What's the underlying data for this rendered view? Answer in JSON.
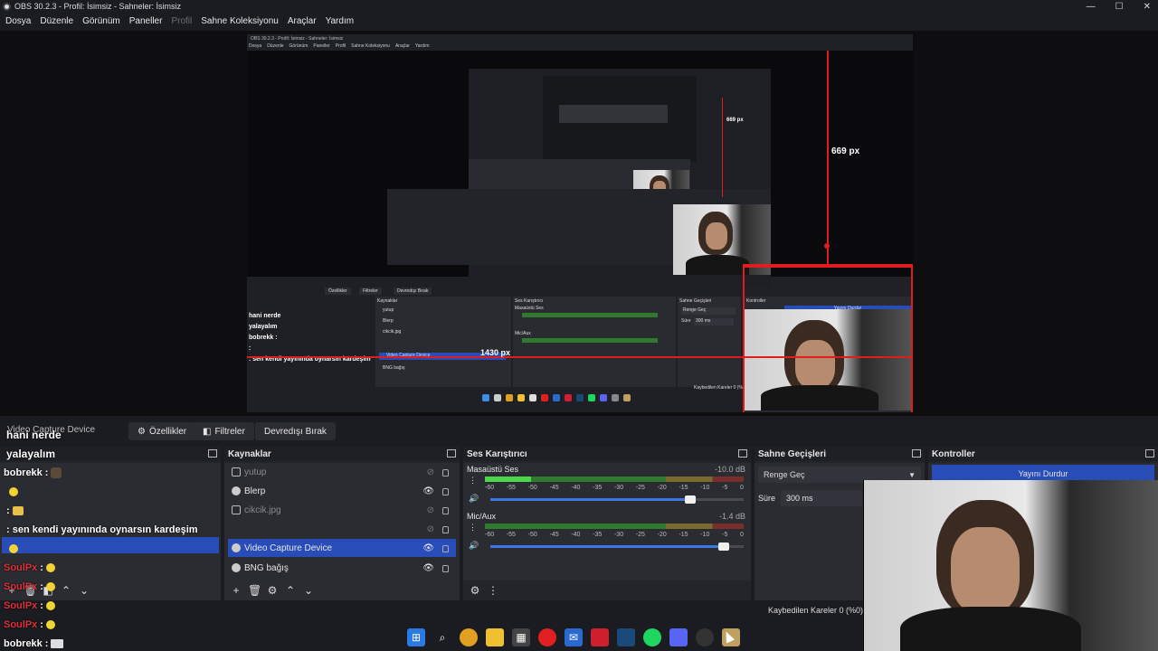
{
  "window": {
    "title": "OBS 30.2.3 - Profil: İsimsiz - Sahneler: İsimsiz",
    "controls": [
      "—",
      "☐",
      "✕"
    ]
  },
  "menu": {
    "items": [
      "Dosya",
      "Düzenle",
      "Görünüm",
      "Paneller",
      "Profil",
      "Sahne Koleksiyonu",
      "Araçlar",
      "Yardım"
    ]
  },
  "preview": {
    "nested_title": "OBS 30.2.3 - Profil: İsimsiz - Sahneler: İsimsiz",
    "measure_669": "669 px",
    "measure_1430": "1430 px",
    "measure_669_small": "669 px",
    "nested_toolbar": [
      "Özellikler",
      "Filtreler",
      "Devredışı Bırak"
    ],
    "nested_docks": [
      "Kaynaklar",
      "Ses Karıştırıcı",
      "Sahne Geçişleri",
      "Kontroller"
    ],
    "nested_sources": [
      "yutup",
      "Blerp",
      "cikcik.jpg",
      "",
      "Video Capture Device",
      "BNG bağış"
    ],
    "nested_mixer": [
      "Masaüstü Ses",
      "Mic/Aux"
    ],
    "nested_trans": "Renge Geç",
    "nested_duration": "Süre",
    "nested_duration_value": "300 ms",
    "nested_stop": "Yayını Durdur",
    "nested_status": "Kaybedilen Kareler 0 (%0)",
    "nested_chat": [
      {
        "user": "",
        "text": "hani nerde"
      },
      {
        "user": "",
        "text": "yalayalım"
      },
      {
        "user": "bobrekk",
        "text": ":"
      },
      {
        "user": "",
        "text": ""
      },
      {
        "user": "",
        "text": ":"
      },
      {
        "user": "",
        "text": ": sen kendi yayınında oynarsın kardeşim"
      },
      {
        "user": "",
        "text": ""
      },
      {
        "user": "bobrekk",
        "text": ":"
      }
    ]
  },
  "toolbar": {
    "source_label": "Video Capture Device",
    "properties": "Özellikler",
    "filters": "Filtreler",
    "deactivate": "Devredışı Bırak"
  },
  "docks": {
    "sources": {
      "title": "Kaynaklar",
      "items": [
        {
          "name": "yutup",
          "visible": false,
          "selected": false
        },
        {
          "name": "Blerp",
          "visible": true,
          "selected": false
        },
        {
          "name": "cikcik.jpg",
          "visible": false,
          "selected": false
        },
        {
          "name": "",
          "visible": false,
          "selected": false
        },
        {
          "name": "Video Capture Device",
          "visible": true,
          "selected": true
        },
        {
          "name": "BNG bağış",
          "visible": true,
          "selected": false
        }
      ]
    },
    "mixer": {
      "title": "Ses Karıştırıcı",
      "channels": [
        {
          "name": "Masaüstü Ses",
          "db": "-10.0 dB",
          "level_pct": 0.18,
          "volume_pct": 0.79
        },
        {
          "name": "Mic/Aux",
          "db": "-1.4 dB",
          "level_pct": 0.0,
          "volume_pct": 0.92
        }
      ],
      "ticks": [
        "-60",
        "-55",
        "-50",
        "-45",
        "-40",
        "-35",
        "-30",
        "-25",
        "-20",
        "-15",
        "-10",
        "-5",
        "0"
      ]
    },
    "transitions": {
      "title": "Sahne Geçişleri",
      "selected": "Renge Geç",
      "duration_label": "Süre",
      "duration_value": "300 ms"
    },
    "controls": {
      "title": "Kontroller",
      "stop_stream": "Yayını Durdur"
    }
  },
  "chat": [
    {
      "user": "",
      "text": "hani nerde",
      "emote": ""
    },
    {
      "user": "",
      "text": "yalayalım",
      "emote": ""
    },
    {
      "user": "bobrekk",
      "text": ":",
      "emote": "face"
    },
    {
      "user": "",
      "text": "",
      "emote": "yellow"
    },
    {
      "user": "",
      "text": ":",
      "emote": "card"
    },
    {
      "user": "",
      "text": ": sen kendi yayınında oynarsın kardeşim",
      "emote": ""
    },
    {
      "user": "",
      "text": "",
      "emote": "yellow"
    },
    {
      "user": "SoulPx",
      "text": ":",
      "emote": "yellow"
    },
    {
      "user": "SoulPx",
      "text": ":",
      "emote": "yellow"
    },
    {
      "user": "SoulPx",
      "text": ":",
      "emote": "yellow"
    },
    {
      "user": "SoulPx",
      "text": ":",
      "emote": "yellow"
    },
    {
      "user": "bobrekk",
      "text": ":",
      "emote": "dark"
    }
  ],
  "status": {
    "dropped_frames": "Kaybedilen Kareler 0 (%0)"
  },
  "colors": {
    "accent": "#284cb8",
    "measure_red": "#e11c1c",
    "chat_user": "#e0303a"
  },
  "taskbar": {
    "icons": [
      "windows-icon",
      "search-icon",
      "chrome-icon",
      "folder-icon",
      "store-icon",
      "opera-icon",
      "mail-icon",
      "app-red-icon",
      "steam-icon",
      "spotify-icon",
      "discord-icon",
      "obs-icon",
      "files-icon"
    ]
  }
}
